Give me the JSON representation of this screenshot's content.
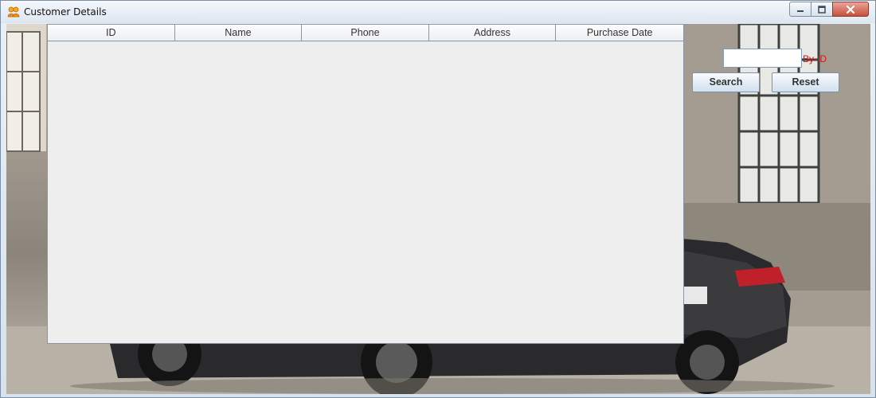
{
  "window": {
    "title": "Customer Details",
    "controls": {
      "minimize": "minimize-icon",
      "maximize": "maximize-icon",
      "close": "close-icon"
    }
  },
  "table": {
    "columns": [
      "ID",
      "Name",
      "Phone",
      "Address",
      "Purchase Date"
    ],
    "rows": []
  },
  "search": {
    "value": "",
    "hint": "By-ID",
    "search_label": "Search",
    "reset_label": "Reset"
  },
  "colors": {
    "hint": "#e01010",
    "table_bg": "#eeeeee",
    "titlebar": "#dde6f0"
  }
}
